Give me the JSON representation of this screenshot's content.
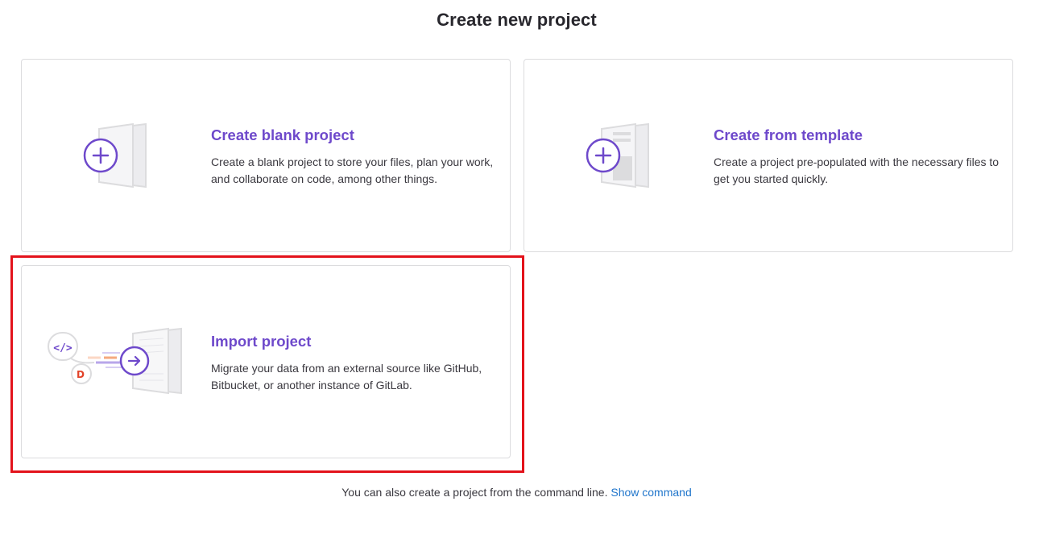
{
  "page": {
    "title": "Create new project"
  },
  "cards": {
    "blank": {
      "title": "Create blank project",
      "description": "Create a blank project to store your files, plan your work, and collaborate on code, among other things.",
      "icon": "blank-project-illustration"
    },
    "template": {
      "title": "Create from template",
      "description": "Create a project pre-populated with the necessary files to get you started quickly.",
      "icon": "template-project-illustration"
    },
    "import": {
      "title": "Import project",
      "description": "Migrate your data from an external source like GitHub, Bitbucket, or another instance of GitLab.",
      "icon": "import-project-illustration",
      "highlighted": true
    }
  },
  "footer": {
    "text": "You can also create a project from the command line.",
    "link_label": "Show command"
  },
  "colors": {
    "accent": "#6e49cb",
    "link": "#1f75cb",
    "highlight": "#e3121b",
    "orange": "#e24329"
  }
}
